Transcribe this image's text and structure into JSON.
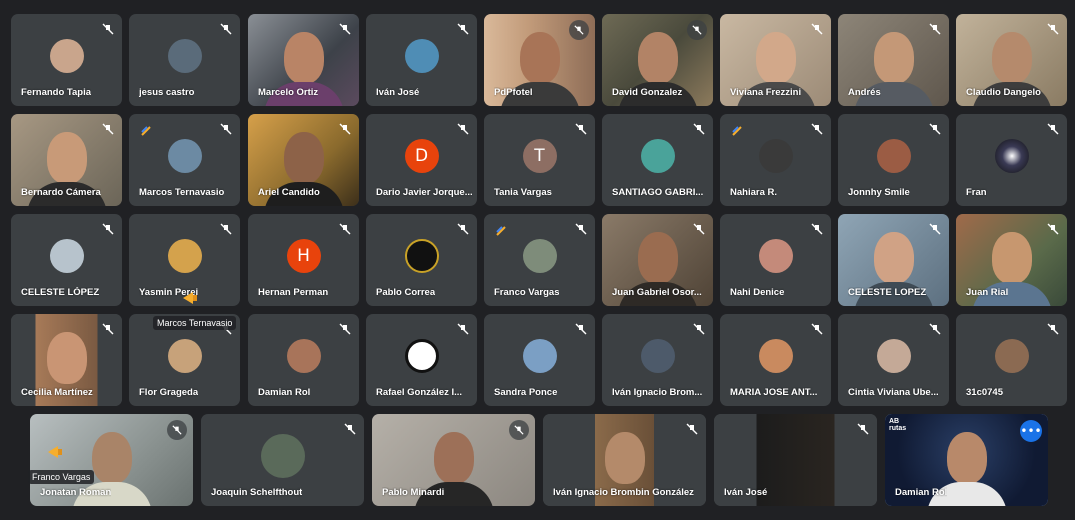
{
  "meeting": {
    "rows": [
      [
        "Fernando Tapia",
        "jesus castro",
        "Marcelo Ortiz",
        "Iván José",
        "PdPfotel",
        "David Gonzalez",
        "Viviana Frezzini",
        "Andrés",
        "Claudio Dangelo"
      ],
      [
        "Bernardo Cámera",
        "Marcos Ternavasio",
        "Ariel Candido",
        "Dario Javier Jorque...",
        "Tania Vargas",
        "SANTIAGO GABRI...",
        "Nahiara R.",
        "Jonnhy Smile",
        "Fran"
      ],
      [
        "CELESTE LÓPEZ",
        "Yasmin Perei",
        "Hernan Perman",
        "Pablo Correa",
        "Franco Vargas",
        "Juan Gabriel Osor...",
        "Nahi Denice",
        "CELESTE LOPEZ",
        "Juan Rial"
      ],
      [
        "Cecilia Martínez",
        "Flor Grageda",
        "Damian Rol",
        "Rafael González I...",
        "Sandra Ponce",
        "Iván Ignacio Brom...",
        "MARIA JOSE ANT...",
        "Cintia Viviana Ube...",
        "31c0745"
      ]
    ],
    "bottom_row": [
      "Jonatan Roman",
      "Joaquin Schelfthout",
      "Pablo Minardi",
      "Iván Ignacio Brombin González",
      "Iván José",
      "Damian Rol"
    ],
    "initials": {
      "dario": "D",
      "tania": "T",
      "hernan": "H"
    },
    "tooltips": {
      "speaking_top": "Marcos Ternavasio",
      "speaking_bottom": "Franco Vargas"
    },
    "more_options": "•••",
    "logo_text": "AB\nrutas",
    "colors": {
      "background": "#202124",
      "tile": "#3c4043",
      "active_outline": "#8ab4f8",
      "button_blue": "#1a73e8"
    }
  }
}
